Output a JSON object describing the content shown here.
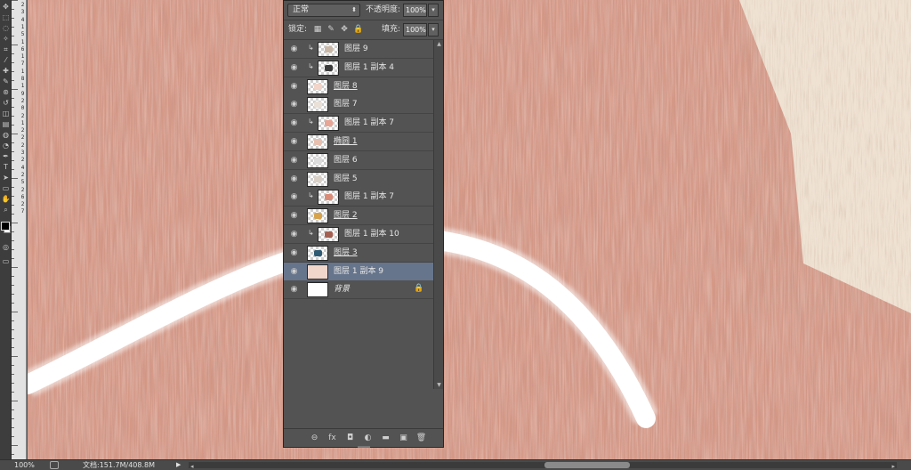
{
  "canvas_colors": {
    "base": "#d69886",
    "dark": "#bf7a66",
    "light": "#ecc3b3",
    "cream": "#efe2d3",
    "stroke": "#ffffff"
  },
  "toolbar": {
    "tools": [
      "move-icon",
      "marquee-icon",
      "lasso-icon",
      "quick-select-icon",
      "crop-icon",
      "eyedropper-icon",
      "healing-brush-icon",
      "brush-icon",
      "clone-stamp-icon",
      "history-brush-icon",
      "eraser-icon",
      "gradient-icon",
      "blur-icon",
      "dodge-icon",
      "pen-icon",
      "type-icon",
      "path-select-icon",
      "shape-icon",
      "hand-icon",
      "zoom-icon"
    ],
    "quickmask_label": "◎",
    "screenmode_label": "▭"
  },
  "ruler": {
    "numbers": [
      "2",
      "3",
      "4",
      "1",
      "5",
      "1",
      "6",
      "1",
      "7",
      "1",
      "8",
      "1",
      "9",
      "2",
      "0",
      "2",
      "1",
      "2",
      "2",
      "2",
      "3",
      "2",
      "4",
      "2",
      "5",
      "2",
      "6",
      "2",
      "7"
    ]
  },
  "layers_panel": {
    "blend_mode": "正常",
    "opacity_label": "不透明度:",
    "opacity_value": "100%",
    "lock_label": "锁定:",
    "fill_label": "填充:",
    "fill_value": "100%",
    "layers": [
      {
        "name": "图层 9",
        "clipped": true,
        "style": "plain",
        "thumb": "#c9b8a8",
        "selected": false
      },
      {
        "name": "图层 1 副本 4",
        "clipped": true,
        "style": "plain",
        "thumb": "#3a3a3a",
        "selected": false
      },
      {
        "name": "图层 8",
        "clipped": false,
        "style": "underline",
        "thumb": "#f2d4c8",
        "selected": false
      },
      {
        "name": "图层 7",
        "clipped": false,
        "style": "plain",
        "thumb": "#e9e0d8",
        "selected": false
      },
      {
        "name": "图层 1 副本 7",
        "clipped": true,
        "style": "plain",
        "thumb": "#e7a596",
        "selected": false
      },
      {
        "name": "椭圆 1",
        "clipped": false,
        "style": "underline",
        "thumb": "#e7c0b0",
        "selected": false
      },
      {
        "name": "图层 6",
        "clipped": false,
        "style": "plain",
        "thumb": "#dcdcdc",
        "selected": false
      },
      {
        "name": "图层 5",
        "clipped": false,
        "style": "plain",
        "thumb": "#d9d0c8",
        "selected": false
      },
      {
        "name": "图层 1 副本 7",
        "clipped": true,
        "style": "plain",
        "thumb": "#d98d79",
        "selected": false
      },
      {
        "name": "图层 2",
        "clipped": false,
        "style": "underline",
        "thumb": "#d7a34d",
        "selected": false
      },
      {
        "name": "图层 1 副本 10",
        "clipped": true,
        "style": "plain",
        "thumb": "#a35f51",
        "selected": false
      },
      {
        "name": "图层 3",
        "clipped": false,
        "style": "underline",
        "thumb": "#2f5a73",
        "selected": false
      },
      {
        "name": "图层 1 副本 9",
        "clipped": false,
        "style": "plain",
        "thumb": "#f1d6cc",
        "selected": true
      },
      {
        "name": "背景",
        "clipped": false,
        "style": "italic",
        "thumb": "#ffffff",
        "selected": false,
        "locked": true
      }
    ],
    "footer_icons": [
      {
        "name": "link-layers-icon",
        "glyph": "⊖"
      },
      {
        "name": "layer-style-fx-icon",
        "glyph": "fx"
      },
      {
        "name": "add-mask-icon",
        "glyph": "◘"
      },
      {
        "name": "adjustment-layer-icon",
        "glyph": "◐"
      },
      {
        "name": "new-group-folder-icon",
        "glyph": "▬"
      },
      {
        "name": "new-layer-icon",
        "glyph": "▣"
      },
      {
        "name": "delete-layer-trash-icon",
        "glyph": "🗑"
      }
    ]
  },
  "status": {
    "zoom": "100%",
    "doc_info": "文档:151.7M/408.8M",
    "menu_arrow": "▶"
  }
}
